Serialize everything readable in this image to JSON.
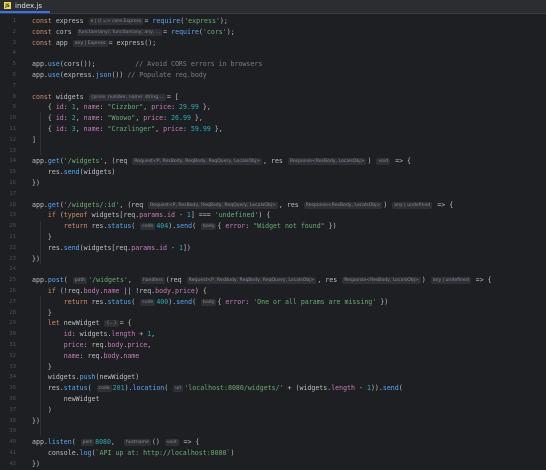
{
  "tab": {
    "file_name": "index.js",
    "badge": "JS"
  },
  "editor": {
    "line_numbers": [
      "1",
      "2",
      "3",
      "4",
      "5",
      "6",
      "7",
      "8",
      "9",
      "10",
      "11",
      "12",
      "13",
      "14",
      "15",
      "16",
      "17",
      "18",
      "19",
      "20",
      "21",
      "22",
      "23",
      "24",
      "25",
      "26",
      "27",
      "28",
      "29",
      "30",
      "31",
      "32",
      "33",
      "34",
      "35",
      "36",
      "37",
      "38",
      "39",
      "40",
      "41",
      "42"
    ],
    "lines": [
      [
        [
          "kw",
          "const "
        ],
        [
          "",
          "express "
        ],
        [
          "hint",
          "e | () => core.Express"
        ],
        [
          "",
          "= "
        ],
        [
          "fn",
          "require"
        ],
        [
          "",
          "("
        ],
        [
          "str",
          "'express'"
        ],
        [
          "",
          ");"
        ]
      ],
      [
        [
          "kw",
          "const "
        ],
        [
          "",
          "cors "
        ],
        [
          "hint",
          "function(any): function(any, any, ..."
        ],
        [
          "",
          "= "
        ],
        [
          "fn",
          "require"
        ],
        [
          "",
          "("
        ],
        [
          "str",
          "'cors'"
        ],
        [
          "",
          ");"
        ]
      ],
      [
        [
          "kw",
          "const "
        ],
        [
          "",
          "app "
        ],
        [
          "hint",
          "any | Express"
        ],
        [
          "",
          "= express();"
        ]
      ],
      [],
      [
        [
          "",
          "app."
        ],
        [
          "fn",
          "use"
        ],
        [
          "",
          "(cors());          "
        ],
        [
          "cmt",
          "// Avoid CORS errors in browsers"
        ]
      ],
      [
        [
          "",
          "app."
        ],
        [
          "fn",
          "use"
        ],
        [
          "",
          "(express."
        ],
        [
          "fn",
          "json"
        ],
        [
          "",
          "()) "
        ],
        [
          "cmt",
          "// Populate req.body"
        ]
      ],
      [],
      [
        [
          "kw",
          "const "
        ],
        [
          "",
          "widgets "
        ],
        [
          "hint",
          "{price: number, name: string,..."
        ],
        [
          "",
          "= ["
        ]
      ],
      [
        [
          "",
          "    { "
        ],
        [
          "prop",
          "id"
        ],
        [
          ": ",
          ""
        ],
        [
          "num",
          "1"
        ],
        [
          "",
          ", "
        ],
        [
          "prop",
          "name"
        ],
        [
          "",
          ": "
        ],
        [
          "str",
          "\"Cizzbor\""
        ],
        [
          "",
          ", "
        ],
        [
          "prop",
          "price"
        ],
        [
          "",
          ": "
        ],
        [
          "num",
          "29.99"
        ],
        [
          "",
          " },"
        ]
      ],
      [
        [
          "",
          "    { "
        ],
        [
          "prop",
          "id"
        ],
        [
          ": ",
          ""
        ],
        [
          "num",
          "2"
        ],
        [
          "",
          ", "
        ],
        [
          "prop",
          "name"
        ],
        [
          "",
          ": "
        ],
        [
          "str",
          "\"Woowo\""
        ],
        [
          "",
          ", "
        ],
        [
          "prop",
          "price"
        ],
        [
          "",
          ": "
        ],
        [
          "num",
          "26.99"
        ],
        [
          "",
          " },"
        ]
      ],
      [
        [
          "",
          "    { "
        ],
        [
          "prop",
          "id"
        ],
        [
          ": ",
          ""
        ],
        [
          "num",
          "3"
        ],
        [
          "",
          ", "
        ],
        [
          "prop",
          "name"
        ],
        [
          "",
          ": "
        ],
        [
          "str",
          "\"Crazlinger\""
        ],
        [
          "",
          ", "
        ],
        [
          "prop",
          "price"
        ],
        [
          "",
          ": "
        ],
        [
          "num",
          "59.99"
        ],
        [
          "",
          " },"
        ]
      ],
      [
        [
          "",
          "]"
        ]
      ],
      [],
      [
        [
          "",
          "app."
        ],
        [
          "fn",
          "get"
        ],
        [
          "",
          "("
        ],
        [
          "str",
          "'/widgets'"
        ],
        [
          "",
          ", (req "
        ],
        [
          "hint",
          "Request<P, ResBody, ReqBody, ReqQuery, LocalsObj>"
        ],
        [
          "",
          ", res "
        ],
        [
          "hint",
          "Response<ResBody, LocalsObj>"
        ],
        [
          "",
          ") "
        ],
        [
          "hint",
          "void"
        ],
        [
          "",
          " => {"
        ]
      ],
      [
        [
          "",
          "    res."
        ],
        [
          "fn",
          "send"
        ],
        [
          "",
          "(widgets)"
        ]
      ],
      [
        [
          "",
          "})"
        ]
      ],
      [],
      [
        [
          "",
          "app."
        ],
        [
          "fn",
          "get"
        ],
        [
          "",
          "("
        ],
        [
          "str",
          "'/widgets/:id'"
        ],
        [
          "",
          ", (req "
        ],
        [
          "hint",
          "Request<P, ResBody, ReqBody, ReqQuery, LocalsObj>"
        ],
        [
          "",
          ", res "
        ],
        [
          "hint",
          "Response<ResBody, LocalsObj>"
        ],
        [
          "",
          ") "
        ],
        [
          "hint",
          "any | undefined"
        ],
        [
          "",
          " => {"
        ]
      ],
      [
        [
          "",
          "    "
        ],
        [
          "kw",
          "if "
        ],
        [
          "",
          "("
        ],
        [
          "kw",
          "typeof"
        ],
        [
          "",
          " widgets[req."
        ],
        [
          "prop",
          "params"
        ],
        [
          "",
          "."
        ],
        [
          "prop",
          "id"
        ],
        [
          "",
          " - "
        ],
        [
          "num",
          "1"
        ],
        [
          "",
          "] === "
        ],
        [
          "str",
          "'undefined'"
        ],
        [
          "",
          ") {"
        ]
      ],
      [
        [
          "",
          "        "
        ],
        [
          "kw",
          "return "
        ],
        [
          "",
          "res."
        ],
        [
          "fn",
          "status"
        ],
        [
          "",
          "( "
        ],
        [
          "hint",
          "code"
        ],
        [
          "num",
          "404"
        ],
        [
          "",
          ")."
        ],
        [
          "fn",
          "send"
        ],
        [
          "",
          "( "
        ],
        [
          "hint",
          "body"
        ],
        [
          "",
          "{ "
        ],
        [
          "prop",
          "error"
        ],
        [
          "",
          ": "
        ],
        [
          "str",
          "\"Widget not found\""
        ],
        [
          "",
          " })"
        ]
      ],
      [
        [
          "",
          "    }"
        ]
      ],
      [
        [
          "",
          "    res."
        ],
        [
          "fn",
          "send"
        ],
        [
          "",
          "(widgets[req."
        ],
        [
          "prop",
          "params"
        ],
        [
          "",
          "."
        ],
        [
          "prop",
          "id"
        ],
        [
          "",
          " - "
        ],
        [
          "num",
          "1"
        ],
        [
          "",
          "])"
        ]
      ],
      [
        [
          "",
          "})"
        ]
      ],
      [],
      [
        [
          "",
          "app."
        ],
        [
          "fn",
          "post"
        ],
        [
          "",
          "( "
        ],
        [
          "hint",
          "path"
        ],
        [
          "str",
          "'/widgets'"
        ],
        [
          "",
          ",  "
        ],
        [
          "hint",
          "handlers"
        ],
        [
          "",
          "(req "
        ],
        [
          "hint",
          "Request<P, ResBody, ReqBody, ReqQuery, LocalsObj>"
        ],
        [
          "",
          ", res "
        ],
        [
          "hint",
          "Response<ResBody, LocalsObj>"
        ],
        [
          "",
          ") "
        ],
        [
          "hint",
          "any | undefined"
        ],
        [
          "",
          " => {"
        ]
      ],
      [
        [
          "",
          "    "
        ],
        [
          "kw",
          "if "
        ],
        [
          "",
          "(!req."
        ],
        [
          "prop",
          "body"
        ],
        [
          "",
          "."
        ],
        [
          "prop",
          "name"
        ],
        [
          "",
          " || !req."
        ],
        [
          "prop",
          "body"
        ],
        [
          "",
          "."
        ],
        [
          "prop",
          "price"
        ],
        [
          "",
          ") {"
        ]
      ],
      [
        [
          "",
          "        "
        ],
        [
          "kw",
          "return "
        ],
        [
          "",
          "res."
        ],
        [
          "fn",
          "status"
        ],
        [
          "",
          "( "
        ],
        [
          "hint",
          "code"
        ],
        [
          "num",
          "400"
        ],
        [
          "",
          ")."
        ],
        [
          "fn",
          "send"
        ],
        [
          "",
          "( "
        ],
        [
          "hint",
          "body"
        ],
        [
          "",
          "{ "
        ],
        [
          "prop",
          "error"
        ],
        [
          "",
          ": "
        ],
        [
          "str",
          "'One or all params are missing'"
        ],
        [
          "",
          " })"
        ]
      ],
      [
        [
          "",
          "    }"
        ]
      ],
      [
        [
          "",
          "    "
        ],
        [
          "kw",
          "let "
        ],
        [
          "",
          "newWidget "
        ],
        [
          "hint",
          "{...}"
        ],
        [
          "",
          "= {"
        ]
      ],
      [
        [
          "",
          "        "
        ],
        [
          "prop",
          "id"
        ],
        [
          "",
          ": widgets."
        ],
        [
          "prop",
          "length"
        ],
        [
          "",
          " + "
        ],
        [
          "num",
          "1"
        ],
        [
          "",
          ","
        ]
      ],
      [
        [
          "",
          "        "
        ],
        [
          "prop",
          "price"
        ],
        [
          "",
          ": req."
        ],
        [
          "prop",
          "body"
        ],
        [
          "",
          "."
        ],
        [
          "prop",
          "price"
        ],
        [
          "",
          ","
        ]
      ],
      [
        [
          "",
          "        "
        ],
        [
          "prop",
          "name"
        ],
        [
          "",
          ": req."
        ],
        [
          "prop",
          "body"
        ],
        [
          "",
          "."
        ],
        [
          "prop",
          "name"
        ]
      ],
      [
        [
          "",
          "    }"
        ]
      ],
      [
        [
          "",
          "    widgets."
        ],
        [
          "fn",
          "push"
        ],
        [
          "",
          "(newWidget)"
        ]
      ],
      [
        [
          "",
          "    res."
        ],
        [
          "fn",
          "status"
        ],
        [
          "",
          "( "
        ],
        [
          "hint",
          "code"
        ],
        [
          "num",
          "201"
        ],
        [
          "",
          ")."
        ],
        [
          "fn",
          "location"
        ],
        [
          "",
          "( "
        ],
        [
          "hint",
          "url"
        ],
        [
          "str",
          "'localhost:8080/widgets/'"
        ],
        [
          "",
          " + (widgets."
        ],
        [
          "prop",
          "length"
        ],
        [
          "",
          " - "
        ],
        [
          "num",
          "1"
        ],
        [
          "",
          "))."
        ],
        [
          "fn",
          "send"
        ],
        [
          "",
          "("
        ]
      ],
      [
        [
          "",
          "        newWidget"
        ]
      ],
      [
        [
          "",
          "    )"
        ]
      ],
      [
        [
          "",
          "})"
        ]
      ],
      [],
      [
        [
          "",
          "app."
        ],
        [
          "fn",
          "listen"
        ],
        [
          "",
          "( "
        ],
        [
          "hint",
          "port"
        ],
        [
          "num",
          "8080"
        ],
        [
          "",
          ",  "
        ],
        [
          "hint",
          "hostname"
        ],
        [
          "",
          "() "
        ],
        [
          "hint",
          "void"
        ],
        [
          "",
          " => {"
        ]
      ],
      [
        [
          "",
          "    console."
        ],
        [
          "fn",
          "log"
        ],
        [
          "",
          "("
        ],
        [
          "str",
          "`API up at: http://localhost:8080`"
        ],
        [
          "",
          ")"
        ]
      ],
      [
        [
          "",
          "})"
        ]
      ]
    ]
  }
}
